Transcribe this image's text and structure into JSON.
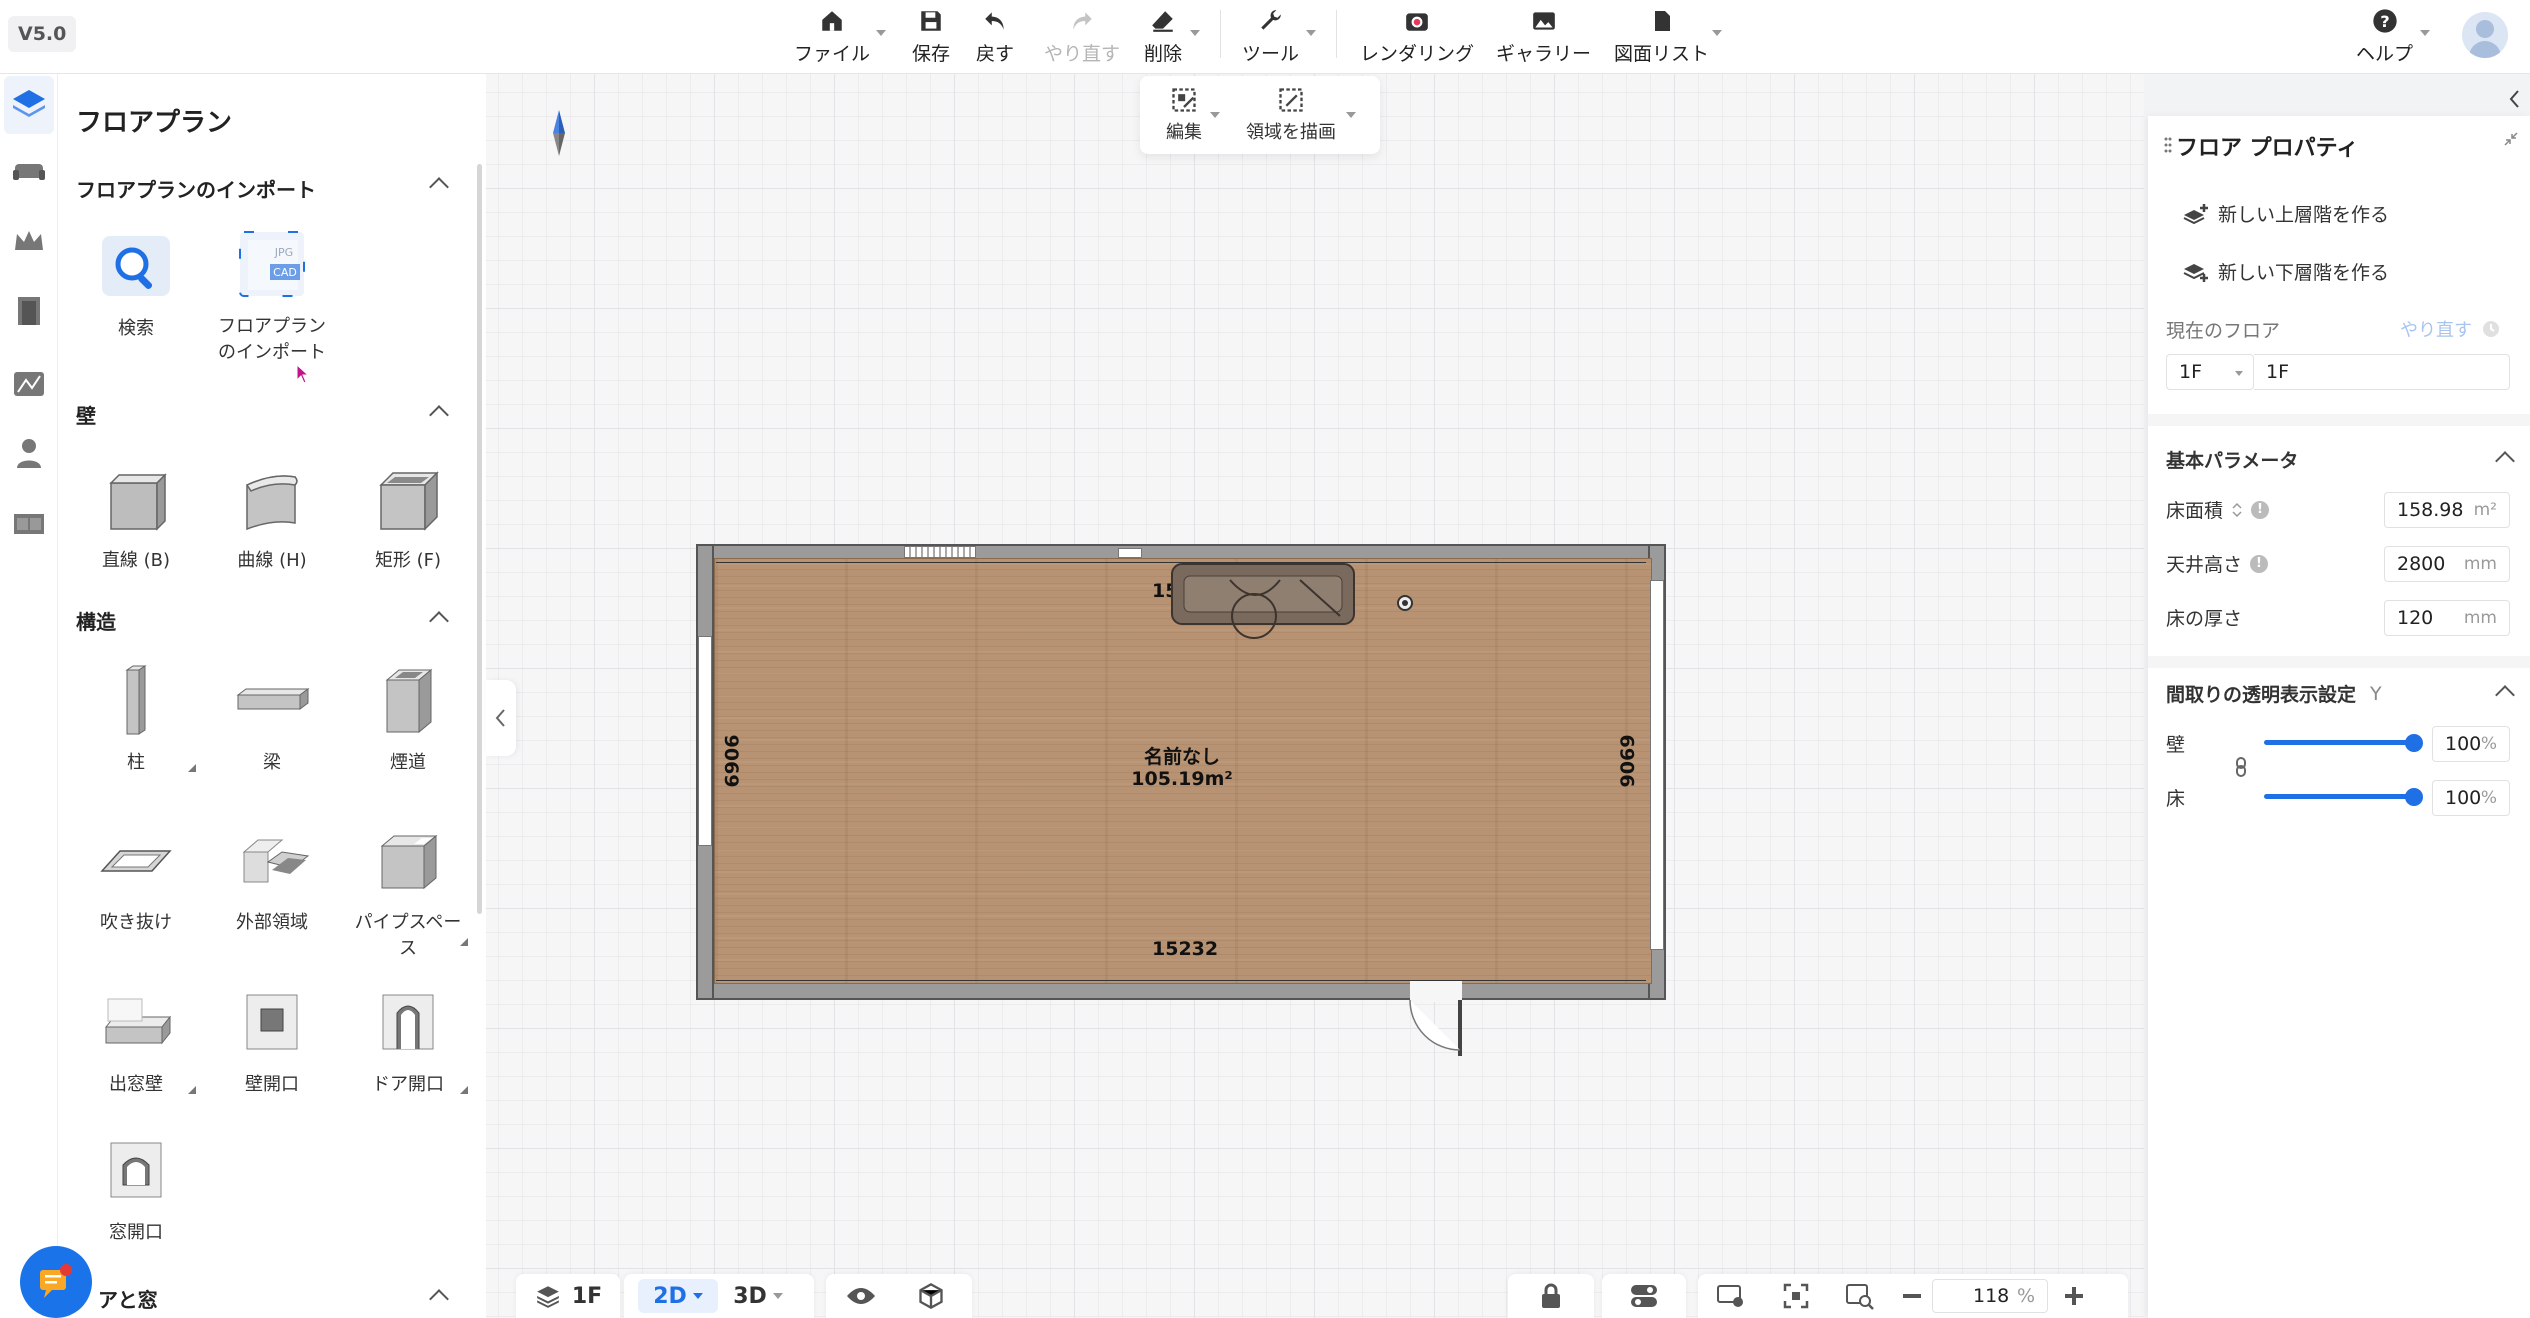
{
  "app": {
    "version": "V5.0"
  },
  "toolbar": {
    "file": "ファイル",
    "save": "保存",
    "undo": "戻す",
    "redo": "やり直す",
    "delete": "削除",
    "tools": "ツール",
    "rendering": "レンダリング",
    "gallery": "ギャラリー",
    "drawing_list": "図面リスト",
    "help": "ヘルプ"
  },
  "float_toolbar": {
    "edit": "編集",
    "draw_area": "領域を描画"
  },
  "catalog": {
    "title": "フロアプラン",
    "sections": {
      "import": {
        "title": "フロアプランのインポート",
        "items": [
          {
            "label": "検索"
          },
          {
            "label": "フロアプラン のインポート",
            "line1": "フロアプラン",
            "line2": "のインポート",
            "badge1": "JPG",
            "badge2": "CAD"
          }
        ]
      },
      "wall": {
        "title": "壁",
        "items": [
          {
            "label": "直線 (B)"
          },
          {
            "label": "曲線 (H)"
          },
          {
            "label": "矩形 (F)"
          }
        ]
      },
      "structure": {
        "title": "構造",
        "items": [
          {
            "label": "柱"
          },
          {
            "label": "梁"
          },
          {
            "label": "煙道"
          },
          {
            "label": "吹き抜け"
          },
          {
            "label": "外部領域"
          },
          {
            "label": "パイプスペース",
            "line1": "パイプスペー",
            "line2": "ス"
          },
          {
            "label": "出窓壁"
          },
          {
            "label": "壁開口"
          },
          {
            "label": "ドア開口"
          },
          {
            "label": "窓開口"
          }
        ]
      },
      "door_window": {
        "title": "アと窓"
      }
    }
  },
  "plan": {
    "room_name": "名前なし",
    "room_area": "105.19m²",
    "dim_top": "15232",
    "dim_bottom": "15232",
    "dim_left": "6906",
    "dim_right": "6906"
  },
  "bottom_bar": {
    "floor": "1F",
    "view2d": "2D",
    "view3d": "3D",
    "zoom_value": "118",
    "zoom_unit": "%"
  },
  "props": {
    "title": "フロア プロパティ",
    "new_upper": "新しい上層階を作る",
    "new_lower": "新しい下層階を作る",
    "current_floor_label": "現在のフロア",
    "redo_link": "やり直す",
    "floor_select": "1F",
    "floor_name": "1F",
    "basic_params": "基本パラメータ",
    "floor_area_label": "床面積",
    "floor_area_value": "158.98",
    "floor_area_unit": "m²",
    "ceiling_label": "天井高さ",
    "ceiling_value": "2800",
    "ceiling_unit": "mm",
    "thickness_label": "床の厚さ",
    "thickness_value": "120",
    "thickness_unit": "mm",
    "transparency_title": "間取りの透明表示設定",
    "transparency_key": "Y",
    "wall_label": "壁",
    "wall_value": "100",
    "floor_label": "床",
    "floor_value": "100",
    "percent": "%",
    "wall_opacity": 1.0,
    "floor_opacity": 1.0
  },
  "colors": {
    "accent": "#1f6fe5",
    "floor_wood": "#b79373",
    "chat": "#1a73e8"
  }
}
